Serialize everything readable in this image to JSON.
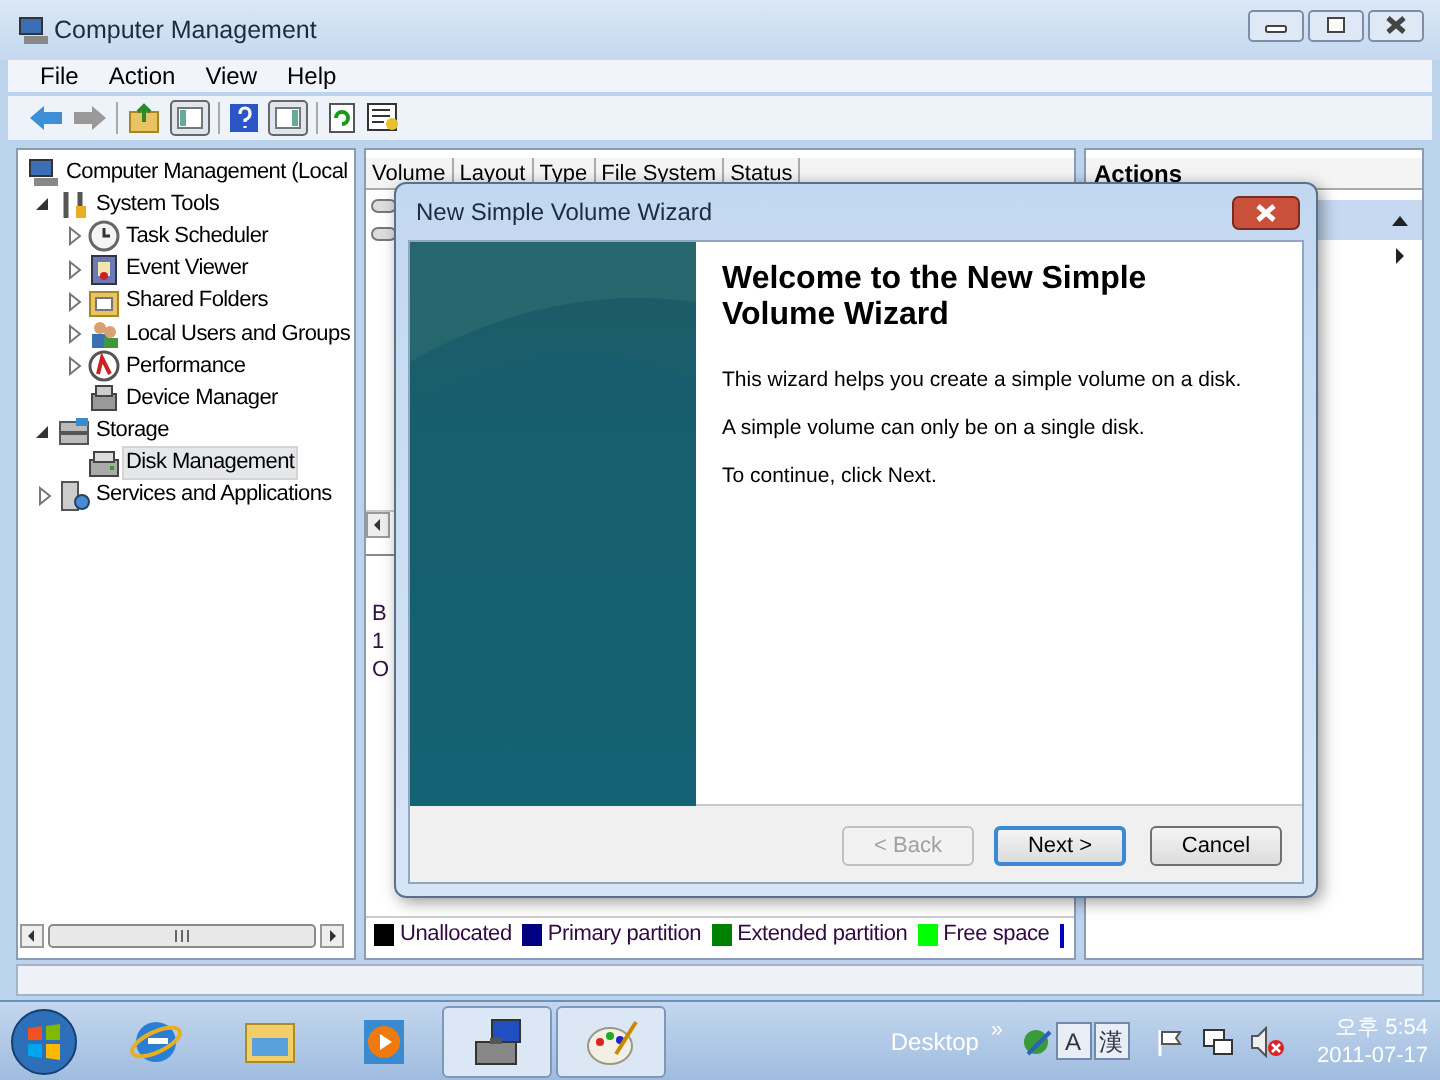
{
  "window": {
    "title": "Computer Management"
  },
  "menu": [
    "File",
    "Action",
    "View",
    "Help"
  ],
  "tree": {
    "label": "Computer Management (Local",
    "selected": false,
    "children": [
      {
        "label": "System Tools",
        "expanded": true,
        "selected": false,
        "children": [
          {
            "label": "Task Scheduler",
            "expanded": false,
            "selected": false
          },
          {
            "label": "Event Viewer",
            "expanded": false,
            "selected": false
          },
          {
            "label": "Shared Folders",
            "expanded": false,
            "selected": false
          },
          {
            "label": "Local Users and Groups",
            "expanded": false,
            "selected": false
          },
          {
            "label": "Performance",
            "expanded": false,
            "selected": false
          },
          {
            "label": "Device Manager",
            "selected": false
          }
        ]
      },
      {
        "label": "Storage",
        "expanded": true,
        "selected": false,
        "children": [
          {
            "label": "Disk Management",
            "selected": true
          }
        ]
      },
      {
        "label": "Services and Applications",
        "expanded": false,
        "selected": false
      }
    ]
  },
  "volume_table": {
    "columns": [
      "Volume",
      "Layout",
      "Type",
      "File System",
      "Status"
    ]
  },
  "disk_info": [
    "B",
    "1",
    "O"
  ],
  "legend": [
    {
      "label": "Unallocated",
      "color": "#000000"
    },
    {
      "label": "Primary partition",
      "color": "#000080"
    },
    {
      "label": "Extended partition",
      "color": "#008000"
    },
    {
      "label": "Free space",
      "color": "#00ff00"
    }
  ],
  "actions": {
    "title": "Actions"
  },
  "wizard": {
    "title": "New Simple Volume Wizard",
    "heading": "Welcome to the New Simple Volume Wizard",
    "paragraphs": [
      "This wizard helps you create a simple volume on a disk.",
      "A simple volume can only be on a single disk.",
      "To continue, click Next."
    ],
    "buttons": [
      {
        "label": "< Back",
        "disabled": true,
        "default": false
      },
      {
        "label": "Next >",
        "disabled": false,
        "default": true
      },
      {
        "label": "Cancel",
        "disabled": false,
        "default": false
      }
    ]
  },
  "taskbar": {
    "apps": [
      {
        "kind": "browser",
        "active": false
      },
      {
        "kind": "folder",
        "active": false
      },
      {
        "kind": "media",
        "active": false
      },
      {
        "kind": "management",
        "active": true
      },
      {
        "kind": "paint",
        "active": true
      }
    ],
    "toolbar_label": "Desktop",
    "overflow": "»",
    "ime": [
      "A",
      "漢"
    ],
    "time": "오후 5:54",
    "date": "2011-07-17"
  }
}
